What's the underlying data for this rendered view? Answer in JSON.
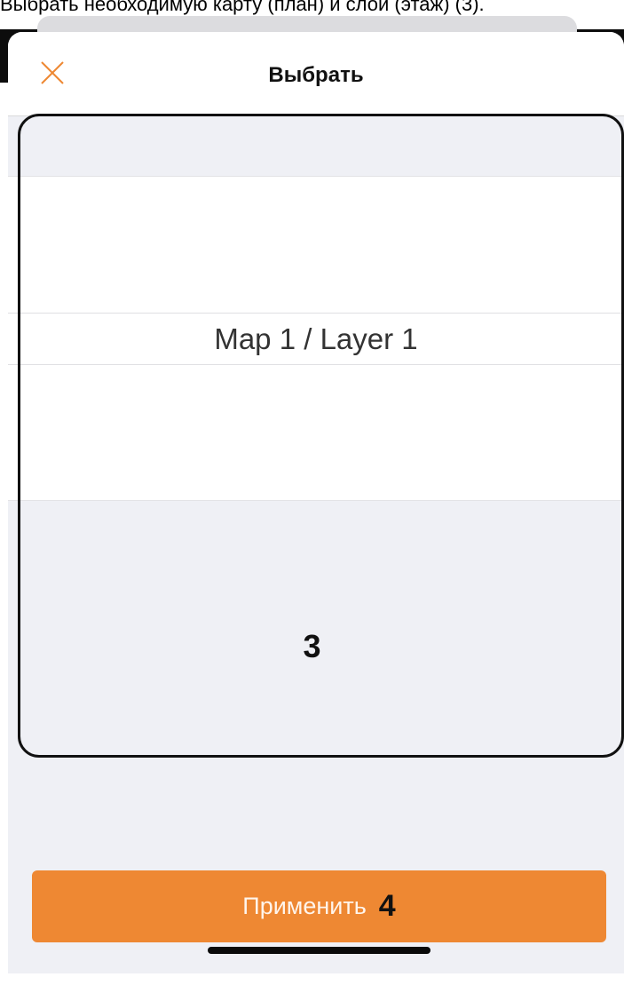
{
  "document": {
    "caption": "Выбрать необходимую карту (план) и слой (этаж) (3)."
  },
  "header": {
    "title": "Выбрать",
    "close_icon": "close-icon"
  },
  "picker": {
    "selected": "Map 1 / Layer 1"
  },
  "annotations": {
    "picker_number": "3",
    "apply_number": "4"
  },
  "footer": {
    "apply_label": "Применить"
  },
  "colors": {
    "accent": "#ee8833",
    "sheet_background": "#eff0f5"
  }
}
